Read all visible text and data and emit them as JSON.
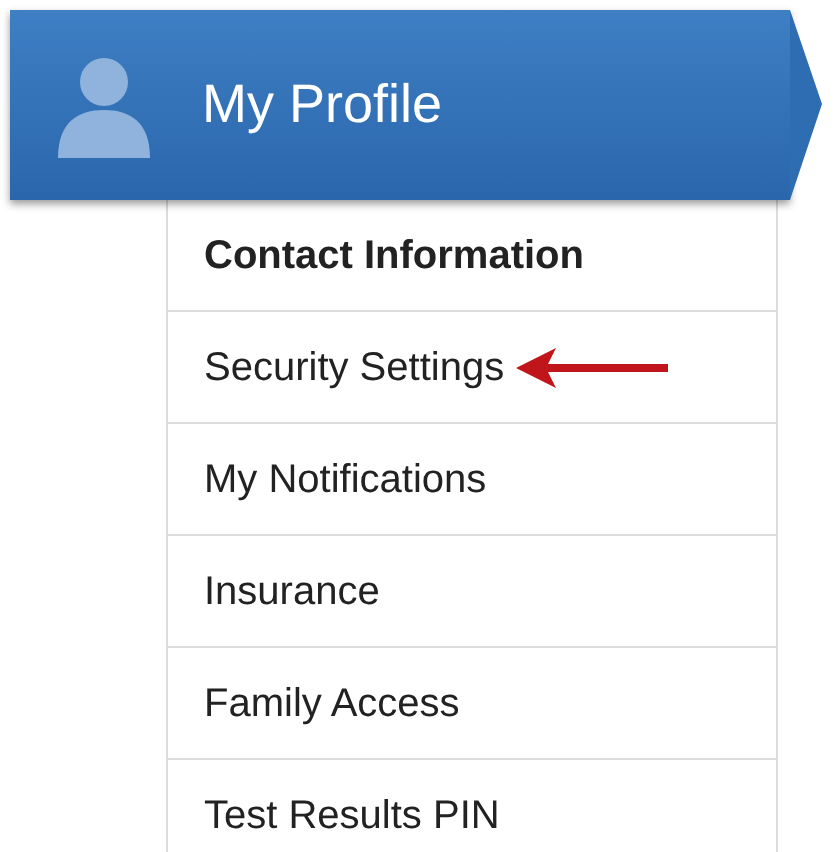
{
  "header": {
    "title": "My Profile"
  },
  "menu": [
    {
      "label": "Contact Information",
      "selected": true,
      "arrow": false
    },
    {
      "label": "Security Settings",
      "selected": false,
      "arrow": true
    },
    {
      "label": "My Notifications",
      "selected": false,
      "arrow": false
    },
    {
      "label": "Insurance",
      "selected": false,
      "arrow": false
    },
    {
      "label": "Family Access",
      "selected": false,
      "arrow": false
    },
    {
      "label": "Test Results PIN",
      "selected": false,
      "arrow": false
    }
  ]
}
